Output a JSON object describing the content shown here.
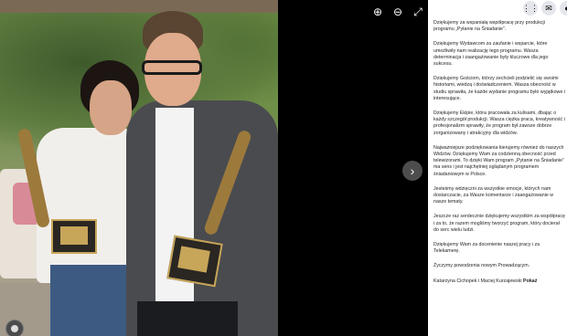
{
  "viewer": {
    "tools": [
      {
        "icon": "zoom-in-icon",
        "glyph": "⊕"
      },
      {
        "icon": "zoom-out-icon",
        "glyph": "⊖"
      },
      {
        "icon": "fullscreen-icon",
        "glyph": "⤢"
      }
    ],
    "next_glyph": "›"
  },
  "topbar": {
    "menu_glyph": "⋮⋮",
    "messenger_glyph": "✉",
    "notifications_glyph": "●"
  },
  "post": {
    "paragraphs": [
      "Dziękujemy za wspaniałą współpracę przy produkcji programu „Pytanie na Śniadanie”.",
      "Dziękujemy Wydawcom za zaufanie i wsparcie, które umożliwiły nam realizację tego programu. Wasza determinacja i zaangażowanie były kluczowe dla jego sukcesu.",
      "Dziękujemy Gościom, którzy zechcieli podzielić się swoimi historiami, wiedzą i doświadczeniem. Wasza obecność w studiu sprawiła, że każde wydanie programu było wyjątkowe i interesujące.",
      "Dziękujemy Ekipie, która pracowała za kulisami, dbając o każdy szczegół produkcji. Wasza ciężka praca, kreatywność i profesjonalizm sprawiły, że program był zawsze dobrze zorganizowany i atrakcyjny dla widzów.",
      "Najważniejsze podziękowania kierujemy również do naszych Widzów. Dziękujemy Wam za codzienną obecność przed telewizorami. To dzięki Wam program „Pytanie na Śniadanie” ma sens i jest najchętniej oglądanym programem śniadaniowym w Polsce.",
      "Jesteśmy wdzięczni za wszystkie emocje, których nam dostarczacie, za Wasze komentarze i zaangażowanie w nasze tematy.",
      "Jeszcze raz serdecznie dziękujemy wszystkim za współpracę i za to, że razem mogliśmy tworzyć program, który docierał do serc wielu ludzi.",
      "Dziękujemy Wam za docenienie naszej pracy i za Telekamerę.",
      "Życzymy powodzenia nowym Prowadzącym."
    ],
    "signature": "Katarzyna Cichopek i Maciej Kurzajewski",
    "show_more": "Pokaż"
  }
}
